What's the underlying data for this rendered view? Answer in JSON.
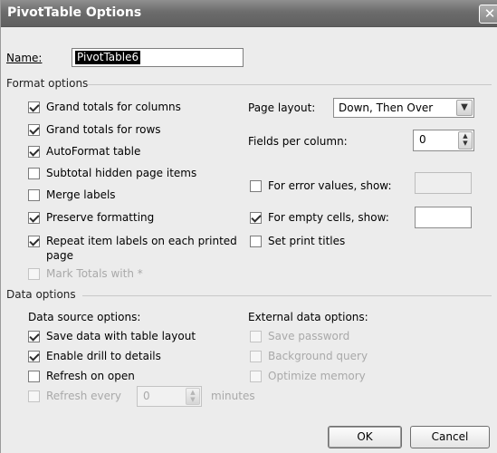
{
  "window": {
    "title": "PivotTable Options",
    "close_glyph": "✕"
  },
  "name": {
    "label": "Name:",
    "value": "PivotTable6"
  },
  "format_options": {
    "group_title": "Format options",
    "grand_totals_columns": {
      "label": "Grand totals for columns",
      "checked": true
    },
    "grand_totals_rows": {
      "label": "Grand totals for rows",
      "checked": true
    },
    "autoformat_table": {
      "label": "AutoFormat table",
      "checked": true
    },
    "subtotal_hidden": {
      "label": "Subtotal hidden page items",
      "checked": false
    },
    "merge_labels": {
      "label": "Merge labels",
      "checked": false
    },
    "preserve_formatting": {
      "label": "Preserve formatting",
      "checked": true
    },
    "repeat_labels": {
      "label_line1": "Repeat item labels on each printed",
      "label_line2": "page",
      "checked": true
    },
    "mark_totals": {
      "label": "Mark Totals with *",
      "checked": false,
      "disabled": true
    },
    "page_layout": {
      "label": "Page layout:",
      "value": "Down, Then Over"
    },
    "fields_per_column": {
      "label": "Fields per column:",
      "value": "0"
    },
    "error_values": {
      "label": "For error values, show:",
      "checked": false,
      "value": ""
    },
    "empty_cells": {
      "label": "For empty cells, show:",
      "checked": true,
      "value": ""
    },
    "print_titles": {
      "label": "Set print titles",
      "checked": false
    }
  },
  "data_options": {
    "group_title": "Data options",
    "source_heading": "Data source options:",
    "save_data": {
      "label": "Save data with table layout",
      "checked": true
    },
    "enable_drill": {
      "label": "Enable drill to details",
      "checked": true
    },
    "refresh_on_open": {
      "label": "Refresh on open",
      "checked": false
    },
    "refresh_every": {
      "label": "Refresh every",
      "value": "0",
      "suffix": "minutes",
      "disabled": true
    },
    "external_heading": "External data options:",
    "save_password": {
      "label": "Save password",
      "disabled": true
    },
    "background_query": {
      "label": "Background query",
      "disabled": true
    },
    "optimize_memory": {
      "label": "Optimize memory",
      "disabled": true
    }
  },
  "buttons": {
    "ok": "OK",
    "cancel": "Cancel"
  }
}
